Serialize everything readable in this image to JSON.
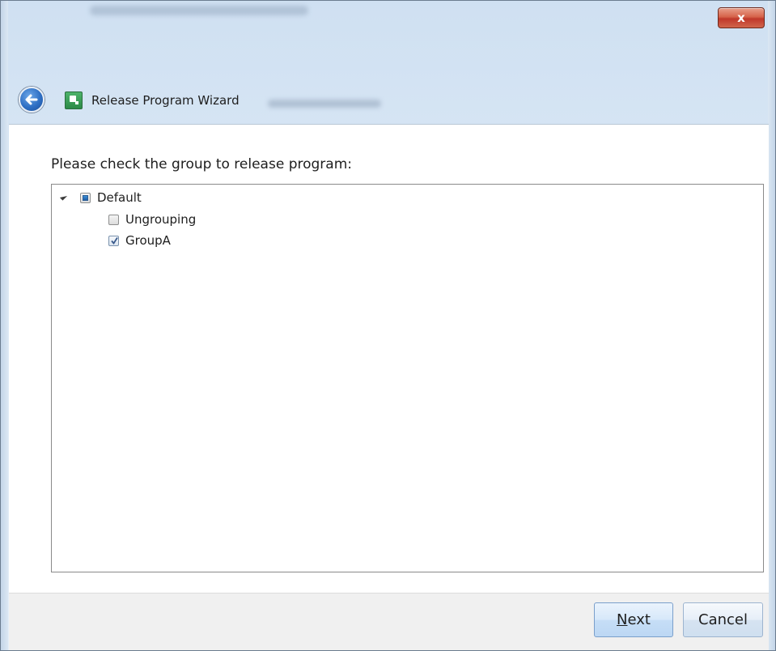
{
  "window": {
    "close_label": "x"
  },
  "header": {
    "title": "Release Program Wizard",
    "back_icon": "back-arrow-icon",
    "app_icon": "app-icon"
  },
  "main": {
    "prompt": "Please check the group to release program:",
    "tree": {
      "root": {
        "label": "Default",
        "expanded": true,
        "check_state": "partial"
      },
      "children": [
        {
          "label": "Ungrouping",
          "checked": false
        },
        {
          "label": "GroupA",
          "checked": true
        }
      ]
    }
  },
  "footer": {
    "next_mnemonic": "N",
    "next_rest": "ext",
    "cancel_label": "Cancel"
  },
  "colors": {
    "accent": "#2e6fc4",
    "close_red": "#c0392b",
    "app_green": "#2c8a47"
  }
}
